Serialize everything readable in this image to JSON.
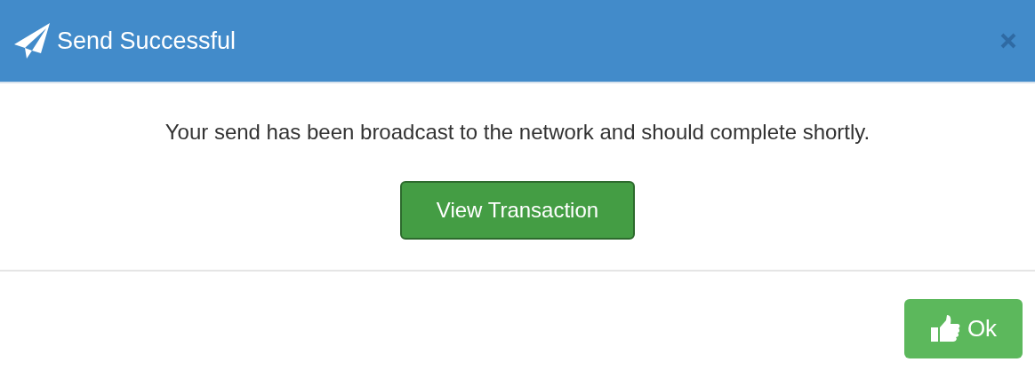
{
  "dialog": {
    "title": "Send Successful",
    "message": "Your send has been broadcast to the network and should complete shortly.",
    "action_button": "View Transaction",
    "footer_button": "Ok"
  }
}
